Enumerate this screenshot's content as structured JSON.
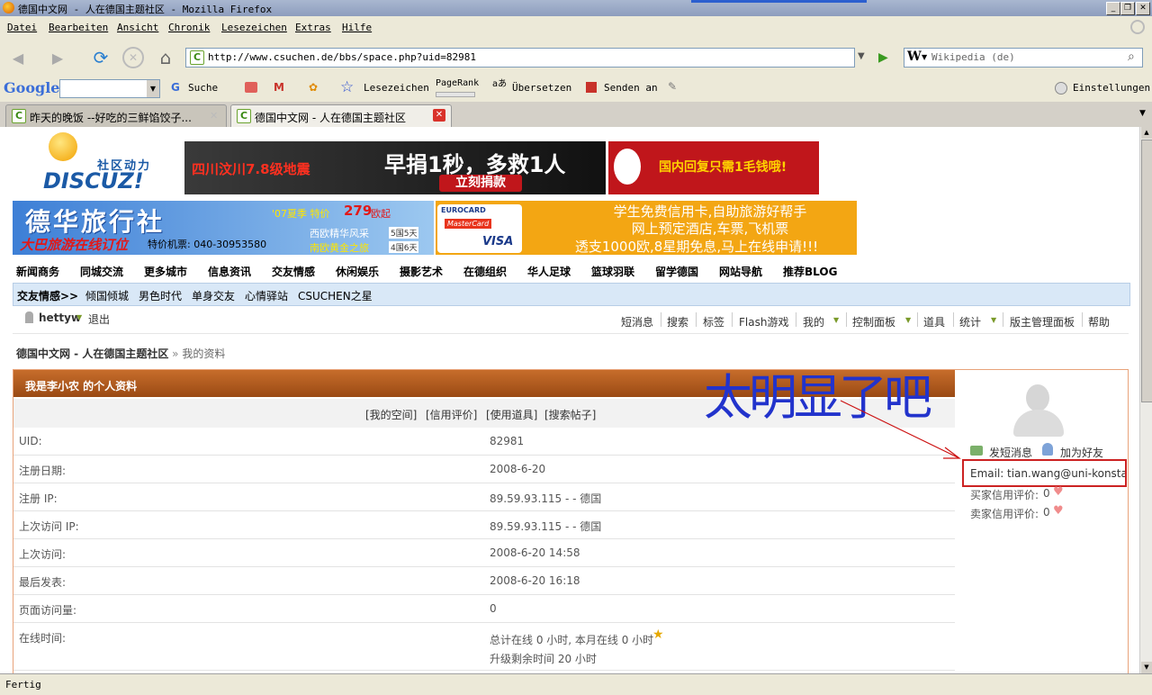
{
  "window": {
    "title": "德国中文网 - 人在德国主题社区 - Mozilla Firefox"
  },
  "menubar": [
    "Datei",
    "Bearbeiten",
    "Ansicht",
    "Chronik",
    "Lesezeichen",
    "Extras",
    "Hilfe"
  ],
  "navbar": {
    "url": "http://www.csuchen.de/bbs/space.php?uid=82981",
    "search_placeholder": "Wikipedia (de)"
  },
  "google_toolbar": {
    "logo": "Google",
    "search_label": "Suche",
    "bookmarks_label": "Lesezeichen",
    "pagerank_label": "PageRank",
    "translate_label": "Übersetzen",
    "send_label": "Senden an",
    "settings_label": "Einstellungen"
  },
  "tabs": [
    {
      "label": "昨天的晚饭 --好吃的三鲜馅饺子...",
      "active": false
    },
    {
      "label": "德国中文网 - 人在德国主题社区",
      "active": true
    }
  ],
  "site": {
    "logo_text": "社区动力",
    "logo_brand": "DISCUZ!",
    "banner1": {
      "left": "四川汶川7.8级地震",
      "main": "早捐1秒，多救1人",
      "button": "立刻捐款"
    },
    "banner2": {
      "text": "国内回复只需1毛钱哦!"
    },
    "banner3": {
      "title": "德华旅行社",
      "sub": "大巴旅游在线订位",
      "promo": "'07夏季 特价",
      "price": "279",
      "unit": "欧起",
      "phone": "特价机票: 040-30953580",
      "tour1": "西欧精华风采",
      "tour2": "南欧黄金之旅",
      "days1": "5国5天",
      "days2": "4国6天"
    },
    "banner4": {
      "l1": "学生免费信用卡,自助旅游好帮手",
      "l2": "网上预定酒店,车票,飞机票",
      "l3": "透支1000欧,8星期免息,马上在线申请!!!",
      "card1": "EUROCARD",
      "card2": "MasterCard",
      "card3": "VISA"
    },
    "nav": [
      "新闻商务",
      "同城交流",
      "更多城市",
      "信息资讯",
      "交友情感",
      "休闲娱乐",
      "摄影艺术",
      "在德组织",
      "华人足球",
      "篮球羽联",
      "留学德国",
      "网站导航",
      "推荐BLOG"
    ],
    "subnav_title": "交友情感>>",
    "subnav": [
      "倾国倾城",
      "男色时代",
      "单身交友",
      "心情驿站",
      "CSUCHEN之星"
    ],
    "user": "hettyw",
    "logout": "退出",
    "toplinks": [
      "短消息",
      "搜索",
      "标签",
      "Flash游戏",
      "我的",
      "控制面板",
      "道具",
      "统计",
      "版主管理面板",
      "帮助"
    ],
    "breadcrumb_home": "德国中文网 - 人在德国主题社区",
    "breadcrumb_sep": "»",
    "breadcrumb_current": "我的资料"
  },
  "profile": {
    "header": "我是李小农 的个人资料",
    "links": [
      "[我的空间]",
      "[信用评价]",
      "[使用道具]",
      "[搜索帖子]"
    ],
    "rows": [
      {
        "k": "UID:",
        "v": "82981"
      },
      {
        "k": "注册日期:",
        "v": "2008-6-20"
      },
      {
        "k": "注册 IP:",
        "v": "89.59.93.115 - - 德国"
      },
      {
        "k": "上次访问 IP:",
        "v": "89.59.93.115 - - 德国"
      },
      {
        "k": "上次访问:",
        "v": "2008-6-20 14:58"
      },
      {
        "k": "最后发表:",
        "v": "2008-6-20 16:18"
      },
      {
        "k": "页面访问量:",
        "v": "0"
      }
    ],
    "online_label": "在线时间:",
    "online_line1": "总计在线 0 小时, 本月在线 0 小时",
    "online_line2": "升级剩余时间 20 小时"
  },
  "sidebar": {
    "send_msg": "发短消息",
    "add_friend": "加为好友",
    "email_label": "Email:",
    "email_value": "tian.wang@uni-konstanz.de",
    "buyer_label": "买家信用评价:",
    "buyer_value": "0",
    "seller_label": "卖家信用评价:",
    "seller_value": "0"
  },
  "annotation": {
    "handwriting": "太明显了吧",
    "color": "#2233cc",
    "arrow_color": "#cc1111"
  },
  "status": {
    "text": "Fertig"
  },
  "colors": {
    "header_brown": "#a8561a",
    "subnav_blue": "#d9e8f7",
    "email_box": "#cc2222"
  }
}
